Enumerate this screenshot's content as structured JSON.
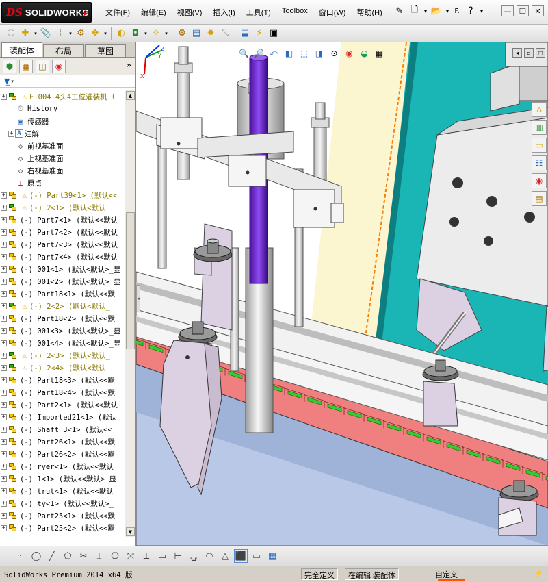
{
  "app": {
    "logo_ds": "DS",
    "logo_text": "SOLIDWORKS"
  },
  "menus": [
    "文件(F)",
    "编辑(E)",
    "视图(V)",
    "插入(I)",
    "工具(T)",
    "Toolbox",
    "窗口(W)",
    "帮助(H)"
  ],
  "std_toolbar": {
    "search_label": "F.",
    "help_icon": "?"
  },
  "left_panel": {
    "tabs": [
      "装配体",
      "布局",
      "草图"
    ],
    "manager_icons": [
      "feature-manager-icon",
      "property-manager-icon",
      "configuration-manager-icon",
      "display-manager-icon"
    ],
    "more_label": "»",
    "filter_icon": "filter-icon",
    "tree": [
      {
        "label": "FI004 4头4工位灌装机",
        "icon": "assembly-icon",
        "warn": true,
        "expand": "plus",
        "tag": "(",
        "indent": 0
      },
      {
        "label": "History",
        "icon": "history-icon",
        "indent": 1
      },
      {
        "label": "传感器",
        "icon": "sensor-icon",
        "indent": 1
      },
      {
        "label": "注解",
        "icon": "annotation-icon",
        "expand": "plus",
        "indent": 1
      },
      {
        "label": "前视基准面",
        "icon": "plane-icon",
        "indent": 1
      },
      {
        "label": "上视基准面",
        "icon": "plane-icon",
        "indent": 1
      },
      {
        "label": "右视基准面",
        "icon": "plane-icon",
        "indent": 1
      },
      {
        "label": "原点",
        "icon": "origin-icon",
        "indent": 1
      },
      {
        "label": "(-) Part39<1> (默认<<",
        "icon": "part-icon",
        "warn": true,
        "expand": "plus",
        "indent": 0
      },
      {
        "label": "(-) 2<1> (默认<默认_",
        "icon": "assembly-icon",
        "warn": true,
        "expand": "plus",
        "indent": 0
      },
      {
        "label": "(-) Part7<1> (默认<<默认",
        "icon": "part-icon",
        "expand": "plus",
        "indent": 0
      },
      {
        "label": "(-) Part7<2> (默认<<默认",
        "icon": "part-icon",
        "expand": "plus",
        "indent": 0
      },
      {
        "label": "(-) Part7<3> (默认<<默认",
        "icon": "part-icon",
        "expand": "plus",
        "indent": 0
      },
      {
        "label": "(-) Part7<4> (默认<<默认",
        "icon": "part-icon",
        "expand": "plus",
        "indent": 0
      },
      {
        "label": "(-) 001<1> (默认<默认>_显",
        "icon": "part-icon",
        "expand": "plus",
        "indent": 0
      },
      {
        "label": "(-) 001<2> (默认<默认>_显",
        "icon": "part-icon",
        "expand": "plus",
        "indent": 0
      },
      {
        "label": "(-) Part18<1> (默认<<默",
        "icon": "part-icon",
        "expand": "plus",
        "indent": 0
      },
      {
        "label": "(-) 2<2> (默认<默认_",
        "icon": "assembly-icon",
        "warn": true,
        "expand": "plus",
        "indent": 0
      },
      {
        "label": "(-) Part18<2> (默认<<默",
        "icon": "part-icon",
        "expand": "plus",
        "indent": 0
      },
      {
        "label": "(-) 001<3> (默认<默认>_显",
        "icon": "part-icon",
        "expand": "plus",
        "indent": 0
      },
      {
        "label": "(-) 001<4> (默认<默认>_显",
        "icon": "part-icon",
        "expand": "plus",
        "indent": 0
      },
      {
        "label": "(-) 2<3> (默认<默认_",
        "icon": "assembly-icon",
        "warn": true,
        "expand": "plus",
        "indent": 0
      },
      {
        "label": "(-) 2<4> (默认<默认_",
        "icon": "assembly-icon",
        "warn": true,
        "expand": "plus",
        "indent": 0
      },
      {
        "label": "(-) Part18<3> (默认<<默",
        "icon": "part-icon",
        "expand": "plus",
        "indent": 0
      },
      {
        "label": "(-) Part18<4> (默认<<默",
        "icon": "part-icon",
        "expand": "plus",
        "indent": 0
      },
      {
        "label": "(-) Part2<1> (默认<<默认",
        "icon": "part-icon",
        "expand": "plus",
        "indent": 0
      },
      {
        "label": "(-) Imported21<1> (默认",
        "icon": "part-icon",
        "expand": "plus",
        "indent": 0
      },
      {
        "label": "(-) Shaft 3<1> (默认<<",
        "icon": "part-icon",
        "expand": "plus",
        "indent": 0
      },
      {
        "label": "(-) Part26<1> (默认<<默",
        "icon": "part-icon",
        "expand": "plus",
        "indent": 0
      },
      {
        "label": "(-) Part26<2> (默认<<默",
        "icon": "part-icon",
        "expand": "plus",
        "indent": 0
      },
      {
        "label": "(-) ryer<1> (默认<<默认",
        "icon": "part-icon",
        "expand": "plus",
        "indent": 0
      },
      {
        "label": "(-) 1<1> (默认<<默认>_显",
        "icon": "part-icon",
        "expand": "plus",
        "indent": 0
      },
      {
        "label": "(-) trut<1> (默认<<默认",
        "icon": "part-icon",
        "expand": "plus",
        "indent": 0
      },
      {
        "label": "(-) ty<1> (默认<<默认>_",
        "icon": "part-icon",
        "expand": "plus",
        "indent": 0
      },
      {
        "label": "(-) Part25<1> (默认<<默",
        "icon": "part-icon",
        "expand": "plus",
        "indent": 0
      },
      {
        "label": "(-) Part25<2> (默认<<默",
        "icon": "part-icon",
        "expand": "plus",
        "indent": 0
      }
    ]
  },
  "triad": {
    "x": "X",
    "y": "Y",
    "z": "Z"
  },
  "status": {
    "version": "SolidWorks Premium 2014 x64 版",
    "definition": "完全定义",
    "editing": "在编辑 装配体",
    "units": "自定义"
  },
  "colors": {
    "conveyor_chain": "#f08080",
    "chain_slot": "#33cc33",
    "purple_rod": "#6a1fd1",
    "teal_panel": "#1ab5b5",
    "cream_panel": "#fbf6d0",
    "status_accent": "#ff5500"
  }
}
